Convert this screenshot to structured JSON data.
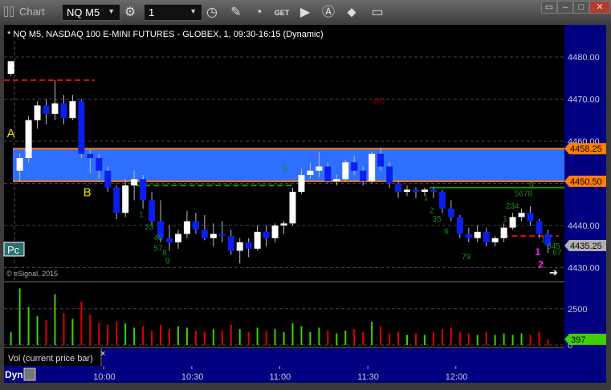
{
  "window": {
    "title": "Chart",
    "symbol": "NQ M5",
    "interval": "1"
  },
  "icons": [
    "settings-icon",
    "clock-icon",
    "pencil-icon",
    "study-icon",
    "get-icon",
    "play-icon",
    "alert-icon",
    "link-icon",
    "comment-icon"
  ],
  "chart_data": {
    "type": "candlestick",
    "title": "* NQ M5, NASDAQ 100 E-MINI FUTURES - GLOBEX, 1, 09:30-16:15 (Dynamic)",
    "copyright": "© eSignal, 2015",
    "price_ticks": [
      "4480.00",
      "4470.00",
      "4460.00",
      "4440.00",
      "4430.00"
    ],
    "price_tick_values": [
      4480,
      4470,
      4460,
      4450,
      4440,
      4430
    ],
    "ylim": [
      4427,
      4486
    ],
    "time_ticks": [
      "10:00",
      "10:30",
      "11:00",
      "11:30",
      "12:00"
    ],
    "xlim": [
      "09:26",
      "12:37"
    ],
    "colors": {
      "up": "#ffffff",
      "down": "#0a1ef0",
      "zone": "#2f6fff",
      "zone_border": "#ff8000",
      "axis_bg": "#000080"
    },
    "zone": {
      "low": 4450.5,
      "high": 4458.25,
      "low_label": "4450.50",
      "high_label": "4458.25"
    },
    "last_price": {
      "value": 4435.25,
      "label": "4435.25"
    },
    "levels": [
      {
        "price": 4474.5,
        "from": "09:26",
        "to": "09:57",
        "color": "#e01010",
        "style": "dashed"
      },
      {
        "price": 4449.5,
        "from": "10:11",
        "to": "11:05",
        "color": "#1a8a1a",
        "style": "dashed"
      },
      {
        "price": 4449,
        "from": "11:51",
        "to": "12:37",
        "color": "#1a8a1a",
        "style": "solid"
      },
      {
        "price": 4437.5,
        "from": "12:16",
        "to": "12:35",
        "color": "#e01010",
        "style": "dashed"
      }
    ],
    "annotations": [
      {
        "text": "A",
        "time": "09:27",
        "price": 4461,
        "color": "#f0e000"
      },
      {
        "text": "B",
        "time": "09:53",
        "price": 4447,
        "color": "#f0e000"
      },
      {
        "text": "(R)",
        "time": "11:32",
        "price": 4469,
        "color": "#8b0000"
      },
      {
        "text": "9",
        "time": "11:01",
        "price": 4453,
        "color": "#1a8a1a"
      },
      {
        "text": "1",
        "time": "10:12",
        "price": 4442,
        "color": "#1a8a1a"
      },
      {
        "text": "23",
        "time": "10:14",
        "price": 4439,
        "color": "#1a8a1a"
      },
      {
        "text": "46",
        "time": "10:17",
        "price": 4436.5,
        "color": "#1a8a1a"
      },
      {
        "text": "57",
        "time": "10:17",
        "price": 4434,
        "color": "#1a8a1a"
      },
      {
        "text": "8",
        "time": "10:20",
        "price": 4433,
        "color": "#1a8a1a"
      },
      {
        "text": "9",
        "time": "10:21",
        "price": 4431,
        "color": "#1a8a1a"
      },
      {
        "text": "1",
        "time": "11:49",
        "price": 4446,
        "color": "#1a8a1a"
      },
      {
        "text": "2",
        "time": "11:51",
        "price": 4443,
        "color": "#1a8a1a"
      },
      {
        "text": "35",
        "time": "11:52",
        "price": 4441,
        "color": "#1a8a1a"
      },
      {
        "text": "6",
        "time": "11:56",
        "price": 4438,
        "color": "#1a8a1a"
      },
      {
        "text": "79",
        "time": "12:02",
        "price": 4432,
        "color": "#1a8a1a"
      },
      {
        "text": "1",
        "time": "12:16",
        "price": 4441,
        "color": "#1a8a1a"
      },
      {
        "text": "234",
        "time": "12:17",
        "price": 4444,
        "color": "#1a8a1a"
      },
      {
        "text": "5678",
        "time": "12:20",
        "price": 4447,
        "color": "#1a8a1a"
      },
      {
        "text": "9",
        "time": "12:25",
        "price": 4449,
        "color": "#1a8a1a"
      },
      {
        "text": "1",
        "time": "12:29",
        "price": 4436,
        "color": "#1a8a1a"
      },
      {
        "text": "345",
        "time": "12:31",
        "price": 4434.5,
        "color": "#1a8a1a"
      },
      {
        "text": "67",
        "time": "12:33",
        "price": 4433,
        "color": "#1a8a1a"
      },
      {
        "text": "1",
        "time": "12:27",
        "price": 4433,
        "color": "#ff20ff"
      },
      {
        "text": "2",
        "time": "12:28",
        "price": 4430,
        "color": "#ff20ff"
      }
    ],
    "pc_label": "Pc",
    "candles": [
      [
        "09:27",
        4476,
        4479,
        4475.5,
        4479
      ],
      [
        "09:30",
        4453,
        4457,
        4450.5,
        4456
      ],
      [
        "09:33",
        4456,
        4466,
        4455,
        4465
      ],
      [
        "09:36",
        4465,
        4469.5,
        4463,
        4468.5
      ],
      [
        "09:39",
        4468.5,
        4470,
        4464,
        4466.5
      ],
      [
        "09:42",
        4466.5,
        4474.5,
        4465,
        4469
      ],
      [
        "09:45",
        4469,
        4471,
        4464,
        4465.5
      ],
      [
        "09:48",
        4465.5,
        4471,
        4465,
        4469.5
      ],
      [
        "09:51",
        4469.5,
        4470,
        4456,
        4457
      ],
      [
        "09:54",
        4457,
        4458,
        4452.5,
        4456
      ],
      [
        "09:57",
        4456,
        4457,
        4451,
        4453
      ],
      [
        "10:00",
        4453,
        4454,
        4448,
        4449
      ],
      [
        "10:03",
        4449,
        4449.5,
        4441.5,
        4443
      ],
      [
        "10:06",
        4443,
        4451,
        4442,
        4449.5
      ],
      [
        "10:09",
        4449.5,
        4453,
        4446,
        4451
      ],
      [
        "10:12",
        4451,
        4452,
        4444,
        4446
      ],
      [
        "10:15",
        4446,
        4448,
        4440,
        4441
      ],
      [
        "10:18",
        4441,
        4446,
        4436,
        4437
      ],
      [
        "10:21",
        4437,
        4440,
        4434,
        4436
      ],
      [
        "10:24",
        4436,
        4439,
        4434.5,
        4438
      ],
      [
        "10:27",
        4438,
        4443.5,
        4437,
        4441
      ],
      [
        "10:30",
        4441,
        4443,
        4438,
        4439
      ],
      [
        "10:33",
        4439,
        4442.5,
        4436.5,
        4437
      ],
      [
        "10:36",
        4437,
        4440.5,
        4435,
        4438
      ],
      [
        "10:39",
        4438,
        4441,
        4436,
        4437.5
      ],
      [
        "10:42",
        4437.5,
        4439,
        4433,
        4434
      ],
      [
        "10:45",
        4434,
        4437,
        4431,
        4436
      ],
      [
        "10:48",
        4436,
        4437,
        4432.5,
        4434.5
      ],
      [
        "10:51",
        4434.5,
        4440,
        4434,
        4438.5
      ],
      [
        "10:54",
        4438.5,
        4440,
        4435,
        4437
      ],
      [
        "10:57",
        4437,
        4440.5,
        4436,
        4440
      ],
      [
        "11:00",
        4440,
        4441,
        4438,
        4440.5
      ],
      [
        "11:03",
        4440.5,
        4449,
        4440,
        4448
      ],
      [
        "11:06",
        4448,
        4453.5,
        4447.5,
        4452
      ],
      [
        "11:09",
        4452,
        4455,
        4451,
        4453
      ],
      [
        "11:12",
        4453,
        4457.5,
        4451.5,
        4454
      ],
      [
        "11:15",
        4454,
        4455,
        4450,
        4450.5
      ],
      [
        "11:18",
        4450.5,
        4452,
        4449.5,
        4451
      ],
      [
        "11:21",
        4451,
        4455.5,
        4450.5,
        4455
      ],
      [
        "11:24",
        4455,
        4456.5,
        4452,
        4453
      ],
      [
        "11:27",
        4453,
        4454,
        4449.5,
        4450.5
      ],
      [
        "11:30",
        4450.5,
        4457.5,
        4450,
        4457
      ],
      [
        "11:33",
        4457,
        4458.5,
        4453,
        4454
      ],
      [
        "11:36",
        4454,
        4455,
        4449,
        4450
      ],
      [
        "11:39",
        4450,
        4450.5,
        4446.5,
        4448
      ],
      [
        "11:42",
        4448,
        4449.5,
        4447,
        4448.5
      ],
      [
        "11:45",
        4448.5,
        4449,
        4446.5,
        4448
      ],
      [
        "11:48",
        4448,
        4449,
        4447,
        4448.5
      ],
      [
        "11:51",
        4448.5,
        4449,
        4446.5,
        4448
      ],
      [
        "11:54",
        4448,
        4448.5,
        4443,
        4444
      ],
      [
        "11:57",
        4444,
        4446,
        4441,
        4442
      ],
      [
        "12:00",
        4442,
        4442.5,
        4437,
        4438
      ],
      [
        "12:03",
        4438,
        4439.5,
        4436,
        4437
      ],
      [
        "12:06",
        4437,
        4440,
        4436,
        4438.5
      ],
      [
        "12:09",
        4438.5,
        4439.5,
        4435,
        4436
      ],
      [
        "12:12",
        4436,
        4437.5,
        4435,
        4437
      ],
      [
        "12:15",
        4437,
        4440.5,
        4436,
        4439.5
      ],
      [
        "12:18",
        4439.5,
        4443,
        4439,
        4442
      ],
      [
        "12:21",
        4442,
        4444,
        4441,
        4443
      ],
      [
        "12:24",
        4443,
        4444.5,
        4440,
        4441
      ],
      [
        "12:27",
        4441,
        4441.5,
        4437,
        4438
      ],
      [
        "12:30",
        4438,
        4439,
        4433.5,
        4435.25
      ]
    ],
    "volume": {
      "label": "Vol (current price bar)",
      "ticks": [
        "2500",
        "0"
      ],
      "tick_values": [
        2500,
        0
      ],
      "ylim": [
        0,
        4200
      ],
      "last": {
        "value": 397,
        "label": "397"
      },
      "colors": {
        "up": "#40d000",
        "down": "#e00000"
      },
      "values": [
        900,
        3900,
        2600,
        2000,
        1700,
        3500,
        2200,
        1800,
        3000,
        2100,
        1500,
        1400,
        1600,
        1500,
        1200,
        1300,
        1000,
        1400,
        1100,
        1300,
        1200,
        1000,
        900,
        1100,
        1000,
        1400,
        1100,
        900,
        1200,
        1000,
        1100,
        900,
        1500,
        1300,
        900,
        1200,
        1000,
        800,
        1000,
        1100,
        900,
        1600,
        1300,
        800,
        900,
        700,
        800,
        700,
        900,
        1100,
        1200,
        900,
        800,
        700,
        900,
        700,
        800,
        700,
        800,
        700,
        900,
        397
      ]
    }
  },
  "footer": {
    "dyn_label": "Dyn",
    "close_tab": "×"
  }
}
